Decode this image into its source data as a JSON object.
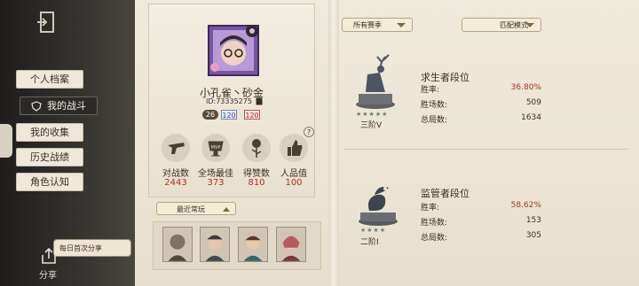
{
  "sidebar": {
    "items": [
      {
        "label": "个人档案"
      },
      {
        "label": "我的战斗"
      },
      {
        "label": "我的收集"
      },
      {
        "label": "历史战绩"
      },
      {
        "label": "角色认知"
      }
    ],
    "share_badge": "每日首次分享",
    "share_label": "分享"
  },
  "profile": {
    "name": "小孔雀丶砂金",
    "id": "ID:73335275",
    "badges": [
      "26",
      "120",
      "120"
    ],
    "stats": [
      {
        "label": "对战数",
        "value": "2443",
        "icon": "pistol-icon"
      },
      {
        "label": "全场最佳",
        "value": "373",
        "icon": "mvp-cup-icon"
      },
      {
        "label": "得赞数",
        "value": "810",
        "icon": "rose-icon"
      },
      {
        "label": "人品值",
        "value": "100",
        "icon": "thumbs-up-icon"
      }
    ]
  },
  "recent": {
    "label": "最近常玩"
  },
  "filters": {
    "season": "所有赛季",
    "mode": "匹配模式"
  },
  "survivor": {
    "title": "求生者段位",
    "tier": "三阶Ⅴ",
    "stars": "★★★★★",
    "rows": [
      {
        "label": "胜率:",
        "value": "36.80%"
      },
      {
        "label": "胜场数:",
        "value": "509"
      },
      {
        "label": "总局数:",
        "value": "1634"
      }
    ]
  },
  "hunter": {
    "title": "监管者段位",
    "tier": "二阶Ⅰ",
    "stars": "★★★★",
    "rows": [
      {
        "label": "胜率:",
        "value": "58.62%"
      },
      {
        "label": "胜场数:",
        "value": "153"
      },
      {
        "label": "总局数:",
        "value": "305"
      }
    ]
  },
  "colors": {
    "accent_red": "#a93224",
    "paper": "#ece5d6",
    "sidebar": "#2b2a28"
  }
}
